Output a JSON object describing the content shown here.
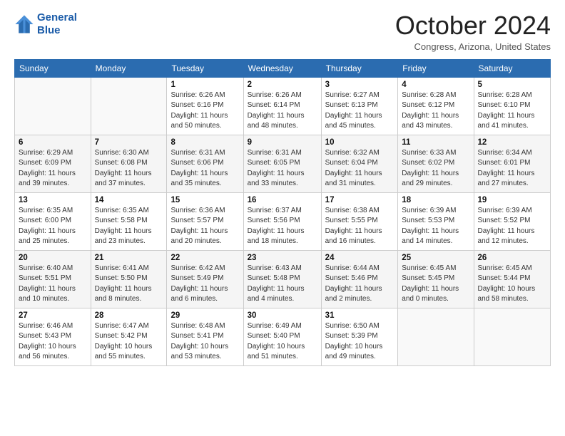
{
  "header": {
    "logo_line1": "General",
    "logo_line2": "Blue",
    "month_title": "October 2024",
    "location": "Congress, Arizona, United States"
  },
  "days_of_week": [
    "Sunday",
    "Monday",
    "Tuesday",
    "Wednesday",
    "Thursday",
    "Friday",
    "Saturday"
  ],
  "weeks": [
    [
      {
        "day": "",
        "sunrise": "",
        "sunset": "",
        "daylight": ""
      },
      {
        "day": "",
        "sunrise": "",
        "sunset": "",
        "daylight": ""
      },
      {
        "day": "1",
        "sunrise": "Sunrise: 6:26 AM",
        "sunset": "Sunset: 6:16 PM",
        "daylight": "Daylight: 11 hours and 50 minutes."
      },
      {
        "day": "2",
        "sunrise": "Sunrise: 6:26 AM",
        "sunset": "Sunset: 6:14 PM",
        "daylight": "Daylight: 11 hours and 48 minutes."
      },
      {
        "day": "3",
        "sunrise": "Sunrise: 6:27 AM",
        "sunset": "Sunset: 6:13 PM",
        "daylight": "Daylight: 11 hours and 45 minutes."
      },
      {
        "day": "4",
        "sunrise": "Sunrise: 6:28 AM",
        "sunset": "Sunset: 6:12 PM",
        "daylight": "Daylight: 11 hours and 43 minutes."
      },
      {
        "day": "5",
        "sunrise": "Sunrise: 6:28 AM",
        "sunset": "Sunset: 6:10 PM",
        "daylight": "Daylight: 11 hours and 41 minutes."
      }
    ],
    [
      {
        "day": "6",
        "sunrise": "Sunrise: 6:29 AM",
        "sunset": "Sunset: 6:09 PM",
        "daylight": "Daylight: 11 hours and 39 minutes."
      },
      {
        "day": "7",
        "sunrise": "Sunrise: 6:30 AM",
        "sunset": "Sunset: 6:08 PM",
        "daylight": "Daylight: 11 hours and 37 minutes."
      },
      {
        "day": "8",
        "sunrise": "Sunrise: 6:31 AM",
        "sunset": "Sunset: 6:06 PM",
        "daylight": "Daylight: 11 hours and 35 minutes."
      },
      {
        "day": "9",
        "sunrise": "Sunrise: 6:31 AM",
        "sunset": "Sunset: 6:05 PM",
        "daylight": "Daylight: 11 hours and 33 minutes."
      },
      {
        "day": "10",
        "sunrise": "Sunrise: 6:32 AM",
        "sunset": "Sunset: 6:04 PM",
        "daylight": "Daylight: 11 hours and 31 minutes."
      },
      {
        "day": "11",
        "sunrise": "Sunrise: 6:33 AM",
        "sunset": "Sunset: 6:02 PM",
        "daylight": "Daylight: 11 hours and 29 minutes."
      },
      {
        "day": "12",
        "sunrise": "Sunrise: 6:34 AM",
        "sunset": "Sunset: 6:01 PM",
        "daylight": "Daylight: 11 hours and 27 minutes."
      }
    ],
    [
      {
        "day": "13",
        "sunrise": "Sunrise: 6:35 AM",
        "sunset": "Sunset: 6:00 PM",
        "daylight": "Daylight: 11 hours and 25 minutes."
      },
      {
        "day": "14",
        "sunrise": "Sunrise: 6:35 AM",
        "sunset": "Sunset: 5:58 PM",
        "daylight": "Daylight: 11 hours and 23 minutes."
      },
      {
        "day": "15",
        "sunrise": "Sunrise: 6:36 AM",
        "sunset": "Sunset: 5:57 PM",
        "daylight": "Daylight: 11 hours and 20 minutes."
      },
      {
        "day": "16",
        "sunrise": "Sunrise: 6:37 AM",
        "sunset": "Sunset: 5:56 PM",
        "daylight": "Daylight: 11 hours and 18 minutes."
      },
      {
        "day": "17",
        "sunrise": "Sunrise: 6:38 AM",
        "sunset": "Sunset: 5:55 PM",
        "daylight": "Daylight: 11 hours and 16 minutes."
      },
      {
        "day": "18",
        "sunrise": "Sunrise: 6:39 AM",
        "sunset": "Sunset: 5:53 PM",
        "daylight": "Daylight: 11 hours and 14 minutes."
      },
      {
        "day": "19",
        "sunrise": "Sunrise: 6:39 AM",
        "sunset": "Sunset: 5:52 PM",
        "daylight": "Daylight: 11 hours and 12 minutes."
      }
    ],
    [
      {
        "day": "20",
        "sunrise": "Sunrise: 6:40 AM",
        "sunset": "Sunset: 5:51 PM",
        "daylight": "Daylight: 11 hours and 10 minutes."
      },
      {
        "day": "21",
        "sunrise": "Sunrise: 6:41 AM",
        "sunset": "Sunset: 5:50 PM",
        "daylight": "Daylight: 11 hours and 8 minutes."
      },
      {
        "day": "22",
        "sunrise": "Sunrise: 6:42 AM",
        "sunset": "Sunset: 5:49 PM",
        "daylight": "Daylight: 11 hours and 6 minutes."
      },
      {
        "day": "23",
        "sunrise": "Sunrise: 6:43 AM",
        "sunset": "Sunset: 5:48 PM",
        "daylight": "Daylight: 11 hours and 4 minutes."
      },
      {
        "day": "24",
        "sunrise": "Sunrise: 6:44 AM",
        "sunset": "Sunset: 5:46 PM",
        "daylight": "Daylight: 11 hours and 2 minutes."
      },
      {
        "day": "25",
        "sunrise": "Sunrise: 6:45 AM",
        "sunset": "Sunset: 5:45 PM",
        "daylight": "Daylight: 11 hours and 0 minutes."
      },
      {
        "day": "26",
        "sunrise": "Sunrise: 6:45 AM",
        "sunset": "Sunset: 5:44 PM",
        "daylight": "Daylight: 10 hours and 58 minutes."
      }
    ],
    [
      {
        "day": "27",
        "sunrise": "Sunrise: 6:46 AM",
        "sunset": "Sunset: 5:43 PM",
        "daylight": "Daylight: 10 hours and 56 minutes."
      },
      {
        "day": "28",
        "sunrise": "Sunrise: 6:47 AM",
        "sunset": "Sunset: 5:42 PM",
        "daylight": "Daylight: 10 hours and 55 minutes."
      },
      {
        "day": "29",
        "sunrise": "Sunrise: 6:48 AM",
        "sunset": "Sunset: 5:41 PM",
        "daylight": "Daylight: 10 hours and 53 minutes."
      },
      {
        "day": "30",
        "sunrise": "Sunrise: 6:49 AM",
        "sunset": "Sunset: 5:40 PM",
        "daylight": "Daylight: 10 hours and 51 minutes."
      },
      {
        "day": "31",
        "sunrise": "Sunrise: 6:50 AM",
        "sunset": "Sunset: 5:39 PM",
        "daylight": "Daylight: 10 hours and 49 minutes."
      },
      {
        "day": "",
        "sunrise": "",
        "sunset": "",
        "daylight": ""
      },
      {
        "day": "",
        "sunrise": "",
        "sunset": "",
        "daylight": ""
      }
    ]
  ]
}
